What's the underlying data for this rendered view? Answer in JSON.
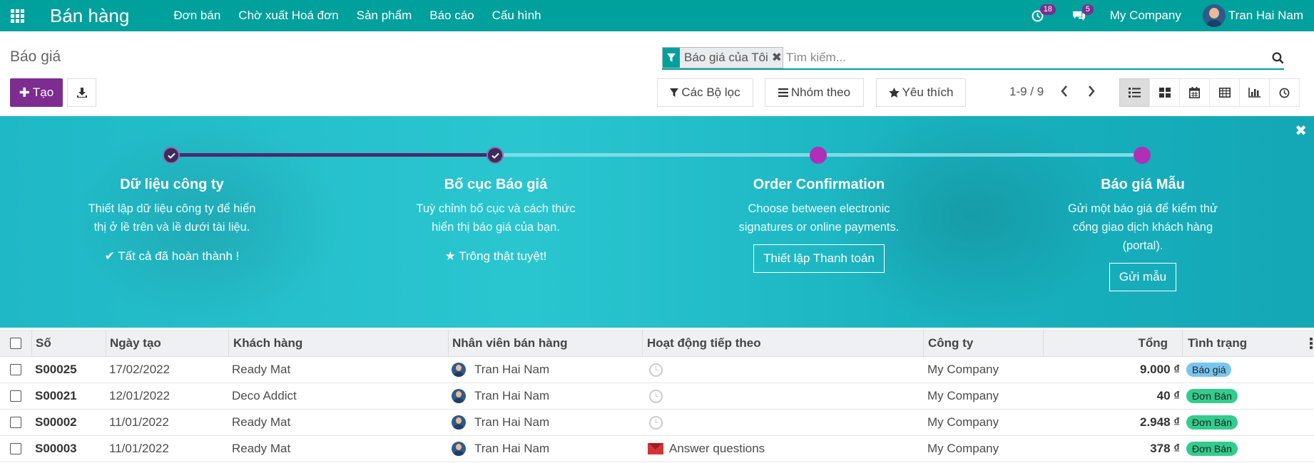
{
  "navbar": {
    "app_title": "Bán hàng",
    "menu": [
      "Đơn bán",
      "Chờ xuất Hoá đơn",
      "Sản phẩm",
      "Báo cáo",
      "Cấu hình"
    ],
    "activity_count": "18",
    "message_count": "5",
    "company": "My Company",
    "user": "Tran Hai Nam"
  },
  "control": {
    "breadcrumb": "Báo giá",
    "create_label": "Tạo",
    "search": {
      "facet": "Báo giá của Tôi",
      "placeholder": "Tìm kiếm..."
    },
    "filters_label": "Các Bộ lọc",
    "group_by_label": "Nhóm theo",
    "favorites_label": "Yêu thích",
    "pager": "1-9 / 9",
    "views": [
      "list-icon",
      "kanban-icon",
      "calendar-icon",
      "pivot-icon",
      "graph-icon",
      "activity-icon"
    ]
  },
  "onboarding": {
    "steps": [
      {
        "title": "Dữ liệu công ty",
        "desc1": "Thiết lập dữ liệu công ty để hiển",
        "desc2": "thị ở lề trên và lề dưới tài liệu.",
        "done": "Tất cả đã hoàn thành !"
      },
      {
        "title": "Bố cục Báo giá",
        "desc1": "Tuỳ chỉnh bố cục và cách thức",
        "desc2": "hiển thị báo giá của bạn.",
        "done": "Trông thật tuyệt!"
      },
      {
        "title": "Order Confirmation",
        "desc1": "Choose between electronic",
        "desc2": "signatures or online payments.",
        "button": "Thiết lập Thanh toán"
      },
      {
        "title": "Báo giá Mẫu",
        "desc1": "Gửi một báo giá để kiểm thử",
        "desc2": "cổng giao dịch khách hàng",
        "desc3": "(portal).",
        "button": "Gửi mẫu"
      }
    ]
  },
  "table": {
    "headers": {
      "number": "Số",
      "date": "Ngày tạo",
      "customer": "Khách hàng",
      "salesperson": "Nhân viên bán hàng",
      "activity": "Hoạt động tiếp theo",
      "company": "Công ty",
      "total": "Tổng",
      "status": "Tình trạng"
    },
    "rows": [
      {
        "number": "S00025",
        "date": "17/02/2022",
        "customer": "Ready Mat",
        "salesperson": "Tran Hai Nam",
        "activity": "",
        "company": "My Company",
        "total": "9.000 ₫",
        "status": "Báo giá"
      },
      {
        "number": "S00021",
        "date": "12/01/2022",
        "customer": "Deco Addict",
        "salesperson": "Tran Hai Nam",
        "activity": "",
        "company": "My Company",
        "total": "40 ₫",
        "status": "Đơn Bán"
      },
      {
        "number": "S00002",
        "date": "11/01/2022",
        "customer": "Ready Mat",
        "salesperson": "Tran Hai Nam",
        "activity": "",
        "company": "My Company",
        "total": "2.948 ₫",
        "status": "Đơn Bán"
      },
      {
        "number": "S00003",
        "date": "11/01/2022",
        "customer": "Ready Mat",
        "salesperson": "Tran Hai Nam",
        "activity": "Answer questions",
        "company": "My Company",
        "total": "378 ₫",
        "status": "Đơn Bán"
      }
    ]
  },
  "colors": {
    "brand": "#00a09d",
    "primary": "#7c2d8f",
    "quotation_badge": "#79c6ef",
    "sales_order_badge": "#33cc8e"
  }
}
